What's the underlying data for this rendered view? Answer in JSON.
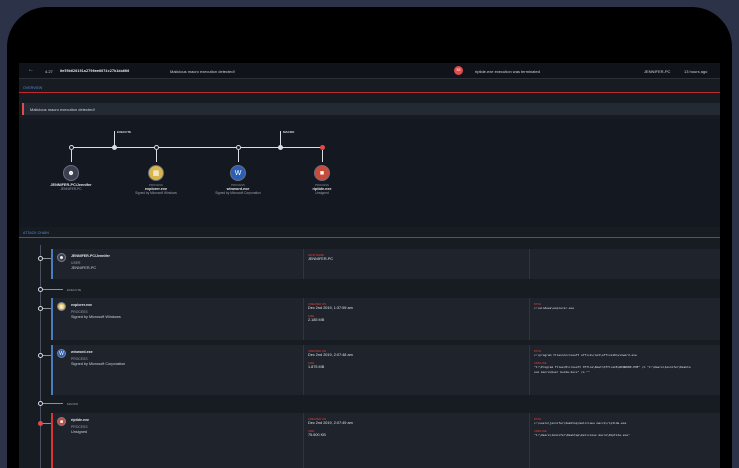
{
  "topbar": {
    "back_icon": "back-arrow-icon",
    "severity": "4.27",
    "hash": "6e59b620191a2796ee6874c27b1da600",
    "title": "Malicious macro execution detected!",
    "notification_count": "55",
    "notification_text": "riptide.exe execution was terminated",
    "hostname": "JENNIFER-PC",
    "time_ago": "13 hours ago"
  },
  "overview": {
    "header": "OVERVIEW",
    "alert_text": "Malicious macro execution detected!"
  },
  "graph": {
    "edge_labels": [
      "EXECUTE",
      "MACRO"
    ],
    "nodes": [
      {
        "kind": "",
        "name": "JENNIFER-PC\\Jennifer",
        "sub": "JENNIFER-PC",
        "icon": "user-icon",
        "color": "#3a4050"
      },
      {
        "kind": "PROCESS",
        "name": "explorer.exe",
        "sub": "Signed by Microsoft Windows",
        "icon": "folder-icon",
        "color": "#d9b44a"
      },
      {
        "kind": "PROCESS",
        "name": "winword.exe",
        "sub": "Signed by Microsoft Corporation",
        "icon": "word-icon",
        "color": "#2b5fb4"
      },
      {
        "kind": "PROCESS",
        "name": "riptide.exe",
        "sub": "Unsigned",
        "icon": "riptide-icon",
        "color": "#c94a3a"
      }
    ]
  },
  "attack_chain": {
    "header": "ATTACK CHAIN",
    "edges": [
      "EXECUTE",
      "MACRO"
    ],
    "cards": [
      {
        "name": "JENNIFER-PC\\Jennifer",
        "type": "USER",
        "sub": "JENNIFER-PC",
        "icon": "user-icon",
        "icon_color": "#3a4050",
        "col2_label": "HOSTNAME",
        "col2_value": "JENNIFER-PC"
      },
      {
        "name": "explorer.exe",
        "type": "PROCESS",
        "sub": "Signed by Microsoft Windows",
        "icon": "folder-icon",
        "icon_color": "#d9b44a",
        "created_label": "CREATED ON",
        "created": "Dec 2nd 2019, 1:37:59 am",
        "size_label": "SIZE",
        "size": "2.185 MB",
        "path_label": "PATH",
        "path": "c:\\windows\\explorer.exe"
      },
      {
        "name": "winword.exe",
        "type": "PROCESS",
        "sub": "Signed by Microsoft Corporation",
        "icon": "word-icon",
        "icon_color": "#2b5fb4",
        "created_label": "CREATED ON",
        "created": "Dec 2nd 2019, 2:07:48 am",
        "size_label": "SIZE",
        "size": "1.875 MB",
        "path_label": "PATH",
        "path": "c:\\program files\\microsoft office\\root\\office16\\winword.exe",
        "cmd_label": "CMDLINE",
        "cmd": "\"C:\\Program Files\\Microsoft Office\\Root\\Office16\\WINWORD.EXE\" /n \"C:\\Users\\Jennifer\\Deskto",
        "cmd2": "oux macro\\User Guide.docx\" /o \"\""
      },
      {
        "name": "riptide.exe",
        "type": "PROCESS",
        "sub": "Unsigned",
        "icon": "riptide-icon",
        "icon_color": "#c94a3a",
        "created_label": "CREATED ON",
        "created": "Dec 2nd 2019, 2:07:49 am",
        "size_label": "SIZE",
        "size": "75.600 KB",
        "path_label": "PATH",
        "path": "c:\\users\\jennifer\\desktop\\malicious macro\\riptide.exe",
        "cmd_label": "CMDLINE",
        "cmd": "\"C:\\Users\\Jennifer\\Desktop\\malicious macro\\Riptide.exe\""
      }
    ]
  }
}
